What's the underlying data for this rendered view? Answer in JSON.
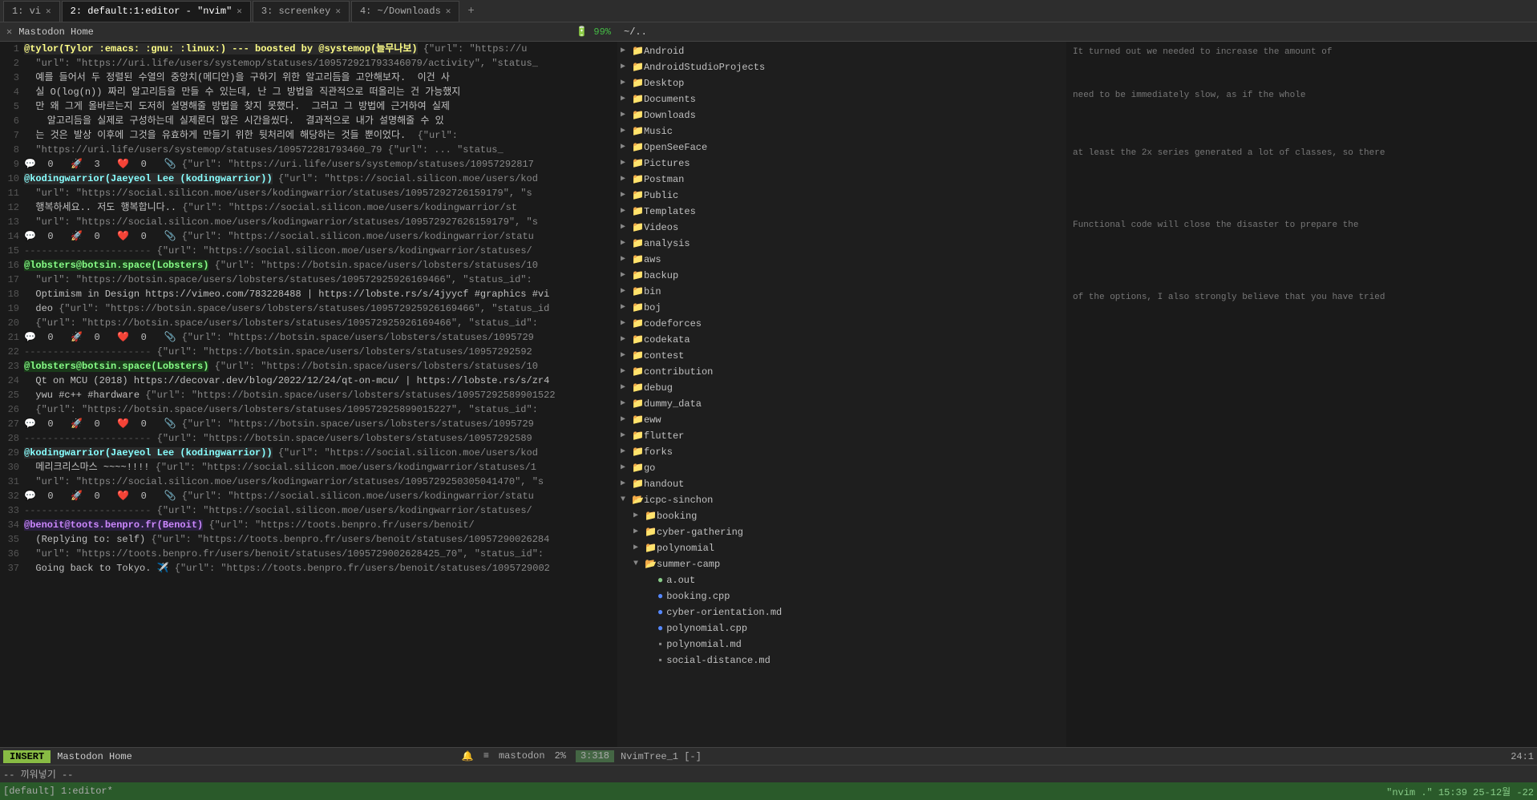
{
  "tabs": [
    {
      "id": 1,
      "label": "1: vi",
      "active": false,
      "closeable": true
    },
    {
      "id": 2,
      "label": "2: default:1:editor - \"nvim\"",
      "active": true,
      "closeable": true
    },
    {
      "id": 3,
      "label": "3: screenkey",
      "active": false,
      "closeable": true
    },
    {
      "id": 4,
      "label": "4: ~/Downloads",
      "active": false,
      "closeable": true
    }
  ],
  "pane_title": "Mastodon Home",
  "battery": "🔋 99%",
  "path_title": "~/..",
  "status": {
    "mode": "INSERT",
    "title": "Mastodon Home",
    "mastodon_label": "mastodon",
    "percent": "2%",
    "position": "3:318",
    "tree_label": "NvimTree_1 [-]",
    "col": "24:1",
    "vim_mode": "[default] 1:editor*",
    "time": "15:39 25-12월 -22",
    "nvim_cmd": "\"nvim .\"",
    "korean_mode": "-- 끼워넣기 --"
  },
  "editor_lines": [
    {
      "num": 1,
      "text": "@tylor(Tylor :emacs: :gnu: :linux:) --- boosted by @systemop(늘무나보)",
      "special": "user1",
      "suffix": " {\"url\": \"https://u"
    },
    {
      "num": 2,
      "text": "  \"url\": \"https://uri.life/users/systemop/statuses/109572921793346079/activity\", \"status_"
    },
    {
      "num": 3,
      "text": "  예를 들어서 두 정렬된 수열의 중앙치(메디안)을 구하기 위한 알고리듬을 고안해보자.  이건 사"
    },
    {
      "num": 4,
      "text": "  실 O(log(n)) 짜리 알고리듬을 만들 수 있는데, 난 그 방법을 직관적으로 떠올리는 건 가능했지"
    },
    {
      "num": 5,
      "text": "  만 왜 그게 올바르는지 도저히 설명해줄 방법을 찾지 못했다.  그러고 그 방법에 근거하여 실제"
    },
    {
      "num": 6,
      "text": "    알고리듬을 실제로 구성하는데 실제론더 많은 시간을씼다.  결과적으로 내가 설명해줄 수 있"
    },
    {
      "num": 7,
      "text": "  는 것은 발상 이후에 그것을 유효하게 만들기 위한 뒷처리에 해당하는 것들 뿐이었다.  {\"url\":"
    },
    {
      "num": 8,
      "text": "  \"https://uri.life/users/systemop/statuses/109572281793460_79 {\"url\": ... \"status_"
    },
    {
      "num": 9,
      "text": "🗨️  0   🚀  3   ❤️  0   📎",
      "suffix": " {\"url\": \"https://uri.life/users/systemop/statuses/10957292817"
    },
    {
      "num": 10,
      "text": "@kodingwarrior(Jaeyeol Lee (kodingwarrior))",
      "special": "user2",
      "suffix": " {\"url\": \"https://social.silicon.moe/users/kod"
    },
    {
      "num": 11,
      "text": "  \"url\": \"https://social.silicon.moe/users/kodingwarrior/statuses/10957292726159179\", \"s"
    },
    {
      "num": 12,
      "text": "  행복하세요.. 저도 행복합니다.. {\"url\": \"https://social.silicon.moe/users/kodingwarrior/st"
    },
    {
      "num": 13,
      "text": "  \"url\": \"https://social.silicon.moe/users/kodingwarrior/statuses/109572927626159179\", \"s"
    },
    {
      "num": 14,
      "text": "🗨️  0   🚀  0   ❤️  0   📎",
      "suffix": " {\"url\": \"https://social.silicon.moe/users/kodingwarrior/statu"
    },
    {
      "num": 15,
      "text": "---------------------- {\"url\": \"https://social.silicon.moe/users/kodingwarrior/statuses/"
    },
    {
      "num": 16,
      "text": "@lobsters@botsin.space(Lobsters)",
      "special": "user3",
      "suffix": " {\"url\": \"https://botsin.space/users/lobsters/statuses/10"
    },
    {
      "num": 17,
      "text": "  \"url\": \"https://botsin.space/users/lobsters/statuses/109572925926169466\", \"status_id\":"
    },
    {
      "num": 18,
      "text": "  Optimism in Design https://vimeo.com/783228488 | https://lobste.rs/s/4jyycf #graphics #vi"
    },
    {
      "num": 19,
      "text": "  deo {\"url\": \"https://botsin.space/users/lobsters/statuses/109572925926169466\", \"status_id"
    },
    {
      "num": 20,
      "text": "  {\"url\": \"https://botsin.space/users/lobsters/statuses/109572925926169466\", \"status_id\":"
    },
    {
      "num": 21,
      "text": "🗨️  0   🚀  0   ❤️  0   📎",
      "suffix": " {\"url\": \"https://botsin.space/users/lobsters/statuses/1095729"
    },
    {
      "num": 22,
      "text": "---------------------- {\"url\": \"https://botsin.space/users/lobsters/statuses/10957292592"
    },
    {
      "num": 23,
      "text": "@lobsters@botsin.space(Lobsters)",
      "special": "user3",
      "suffix": " {\"url\": \"https://botsin.space/users/lobsters/statuses/10"
    },
    {
      "num": 24,
      "text": "  Qt on MCU (2018) https://decovar.dev/blog/2022/12/24/qt-on-mcu/ | https://lobste.rs/s/zr4"
    },
    {
      "num": 25,
      "text": "  ywu #c++ #hardware {\"url\": \"https://botsin.space/users/lobsters/statuses/10957292589901522"
    },
    {
      "num": 26,
      "text": "  {\"url\": \"https://botsin.space/users/lobsters/statuses/109572925899015227\", \"status_id\":"
    },
    {
      "num": 27,
      "text": "🗨️  0   🚀  0   ❤️  0   📎",
      "suffix": " {\"url\": \"https://botsin.space/users/lobsters/statuses/1095729"
    },
    {
      "num": 28,
      "text": "---------------------- {\"url\": \"https://botsin.space/users/lobsters/statuses/10957292589"
    },
    {
      "num": 29,
      "text": "@kodingwarrior(Jaeyeol Lee (kodingwarrior))",
      "special": "user2",
      "suffix": " {\"url\": \"https://social.silicon.moe/users/kod"
    },
    {
      "num": 30,
      "text": "  메리크리스마스 ~~~~!!!! {\"url\": \"https://social.silicon.moe/users/kodingwarrior/statuses/1"
    },
    {
      "num": 31,
      "text": "  \"url\": \"https://social.silicon.moe/users/kodingwarrior/statuses/1095729250305041470\", \"s"
    },
    {
      "num": 32,
      "text": "🗨️  0   🚀  0   ❤️  0   📎",
      "suffix": " {\"url\": \"https://social.silicon.moe/users/kodingwarrior/statu"
    },
    {
      "num": 33,
      "text": "---------------------- {\"url\": \"https://social.silicon.moe/users/kodingwarrior/statuses/"
    },
    {
      "num": 34,
      "text": "@benoit@toots.benpro.fr(Benoit)",
      "special": "user4",
      "suffix": " {\"url\": \"https://toots.benpro.fr/users/benoit/"
    },
    {
      "num": 35,
      "text": "  (Replying to: self) {\"url\": \"https://toots.benpro.fr/users/benoit/statuses/10957290026284"
    },
    {
      "num": 36,
      "text": "  \"url\": \"https://toots.benpro.fr/users/benoit/statuses/1095729002628425_70\", \"status_id\":"
    },
    {
      "num": 37,
      "text": "  Going back to Tokyo. ✈️ {\"url\": \"https://toots.benpro.fr/users/benoit/statuses/1095729002"
    }
  ],
  "tree_items": [
    {
      "level": 0,
      "arrow": "▶",
      "type": "folder",
      "name": "Android",
      "indent": 4
    },
    {
      "level": 0,
      "arrow": "▶",
      "type": "folder",
      "name": "AndroidStudioProjects",
      "indent": 4
    },
    {
      "level": 0,
      "arrow": "▶",
      "type": "folder",
      "name": "Desktop",
      "indent": 4
    },
    {
      "level": 0,
      "arrow": "▶",
      "type": "folder",
      "name": "Documents",
      "indent": 4
    },
    {
      "level": 0,
      "arrow": "▶",
      "type": "folder",
      "name": "Downloads",
      "indent": 4
    },
    {
      "level": 0,
      "arrow": "▶",
      "type": "folder",
      "name": "Music",
      "indent": 4
    },
    {
      "level": 0,
      "arrow": "▶",
      "type": "folder",
      "name": "OpenSeeFace",
      "indent": 4
    },
    {
      "level": 0,
      "arrow": "▶",
      "type": "folder",
      "name": "Pictures",
      "indent": 4
    },
    {
      "level": 0,
      "arrow": "▶",
      "type": "folder",
      "name": "Postman",
      "indent": 4
    },
    {
      "level": 0,
      "arrow": "▶",
      "type": "folder",
      "name": "Public",
      "indent": 4
    },
    {
      "level": 0,
      "arrow": "▶",
      "type": "folder",
      "name": "Templates",
      "indent": 4
    },
    {
      "level": 0,
      "arrow": "▶",
      "type": "folder",
      "name": "Videos",
      "indent": 4
    },
    {
      "level": 0,
      "arrow": "▶",
      "type": "folder",
      "name": "analysis",
      "indent": 4
    },
    {
      "level": 0,
      "arrow": "▶",
      "type": "folder",
      "name": "aws",
      "indent": 4
    },
    {
      "level": 0,
      "arrow": "▶",
      "type": "folder",
      "name": "backup",
      "indent": 4
    },
    {
      "level": 0,
      "arrow": "▶",
      "type": "folder",
      "name": "bin",
      "indent": 4
    },
    {
      "level": 0,
      "arrow": "▶",
      "type": "folder",
      "name": "boj",
      "indent": 4
    },
    {
      "level": 0,
      "arrow": "▶",
      "type": "folder",
      "name": "codeforces",
      "indent": 4
    },
    {
      "level": 0,
      "arrow": "▶",
      "type": "folder",
      "name": "codekata",
      "indent": 4
    },
    {
      "level": 0,
      "arrow": "▶",
      "type": "folder",
      "name": "contest",
      "indent": 4
    },
    {
      "level": 0,
      "arrow": "▶",
      "type": "folder",
      "name": "contribution",
      "indent": 4
    },
    {
      "level": 0,
      "arrow": "▶",
      "type": "folder",
      "name": "debug",
      "indent": 4
    },
    {
      "level": 0,
      "arrow": "▶",
      "type": "folder",
      "name": "dummy_data",
      "indent": 4
    },
    {
      "level": 0,
      "arrow": "▶",
      "type": "folder",
      "name": "eww",
      "indent": 4
    },
    {
      "level": 0,
      "arrow": "▶",
      "type": "folder",
      "name": "flutter",
      "indent": 4
    },
    {
      "level": 0,
      "arrow": "▶",
      "type": "folder",
      "name": "forks",
      "indent": 4
    },
    {
      "level": 0,
      "arrow": "▶",
      "type": "folder",
      "name": "go",
      "indent": 4
    },
    {
      "level": 0,
      "arrow": "▶",
      "type": "folder",
      "name": "handout",
      "indent": 4
    },
    {
      "level": 0,
      "arrow": "▼",
      "type": "folder",
      "name": "icpc-sinchon",
      "indent": 4,
      "open": true
    },
    {
      "level": 1,
      "arrow": "▶",
      "type": "folder",
      "name": "booking",
      "indent": 20
    },
    {
      "level": 1,
      "arrow": "▶",
      "type": "folder",
      "name": "cyber-gathering",
      "indent": 20
    },
    {
      "level": 1,
      "arrow": "▶",
      "type": "folder",
      "name": "polynomial",
      "indent": 20
    },
    {
      "level": 1,
      "arrow": "▼",
      "type": "folder",
      "name": "summer-camp",
      "indent": 20,
      "open": true
    },
    {
      "level": 2,
      "arrow": "",
      "type": "file-out",
      "name": "a.out",
      "indent": 36
    },
    {
      "level": 2,
      "arrow": "",
      "type": "file-cpp",
      "name": "booking.cpp",
      "indent": 36
    },
    {
      "level": 2,
      "arrow": "",
      "type": "file-cpp",
      "name": "cyber-orientation.md",
      "indent": 36
    },
    {
      "level": 2,
      "arrow": "",
      "type": "file-cpp",
      "name": "polynomial.cpp",
      "indent": 36
    },
    {
      "level": 2,
      "arrow": "",
      "type": "file-md",
      "name": "polynomial.md",
      "indent": 36
    },
    {
      "level": 2,
      "arrow": "",
      "type": "file-md",
      "name": "social-distance.md",
      "indent": 36
    }
  ],
  "commentary_lines": [
    "It turned out we needed to increase the amount of",
    "",
    "need to be immediately slow, as if the whole",
    "",
    "",
    "at least the 2x series generated a lot of classes, so there",
    "",
    "",
    "",
    "",
    "Functional code will close the disaster to prepare the",
    "",
    "",
    "of the options, I also strongly believe that you have tried"
  ]
}
